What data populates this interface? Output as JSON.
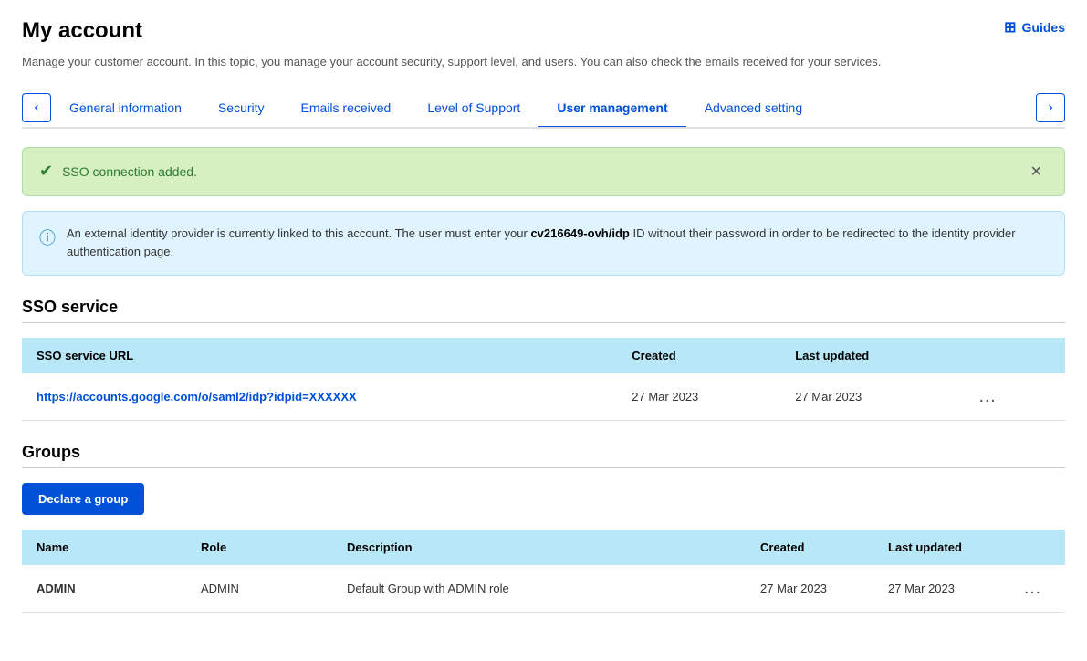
{
  "page": {
    "title": "My account",
    "subtitle": "Manage your customer account. In this topic, you manage your account security, support level, and users. You can also check the emails received for your services.",
    "guides_label": "Guides"
  },
  "tabs": {
    "items": [
      {
        "id": "general",
        "label": "General information",
        "active": false
      },
      {
        "id": "security",
        "label": "Security",
        "active": false
      },
      {
        "id": "emails",
        "label": "Emails received",
        "active": false
      },
      {
        "id": "support",
        "label": "Level of Support",
        "active": false
      },
      {
        "id": "users",
        "label": "User management",
        "active": true
      },
      {
        "id": "advanced",
        "label": "Advanced setting",
        "active": false
      }
    ]
  },
  "banners": {
    "success": {
      "text": "SSO connection added."
    },
    "info": {
      "text_before": "An external identity provider is currently linked to this account. The user must enter your ",
      "highlight": "cv216649-ovh/idp",
      "text_after": " ID without their password in order to be redirected to the identity provider authentication page."
    }
  },
  "sso_section": {
    "title": "SSO service",
    "table": {
      "headers": [
        "SSO service URL",
        "Created",
        "Last updated",
        ""
      ],
      "rows": [
        {
          "url": "https://accounts.google.com/o/saml2/idp?idpid=XXXXXX",
          "created": "27 Mar 2023",
          "last_updated": "27 Mar 2023"
        }
      ]
    }
  },
  "groups_section": {
    "title": "Groups",
    "declare_button": "Declare a group",
    "table": {
      "headers": [
        "Name",
        "Role",
        "Description",
        "Created",
        "Last updated",
        ""
      ],
      "rows": [
        {
          "name": "ADMIN",
          "role": "ADMIN",
          "description": "Default Group with ADMIN role",
          "created": "27 Mar 2023",
          "last_updated": "27 Mar 2023"
        }
      ]
    }
  }
}
